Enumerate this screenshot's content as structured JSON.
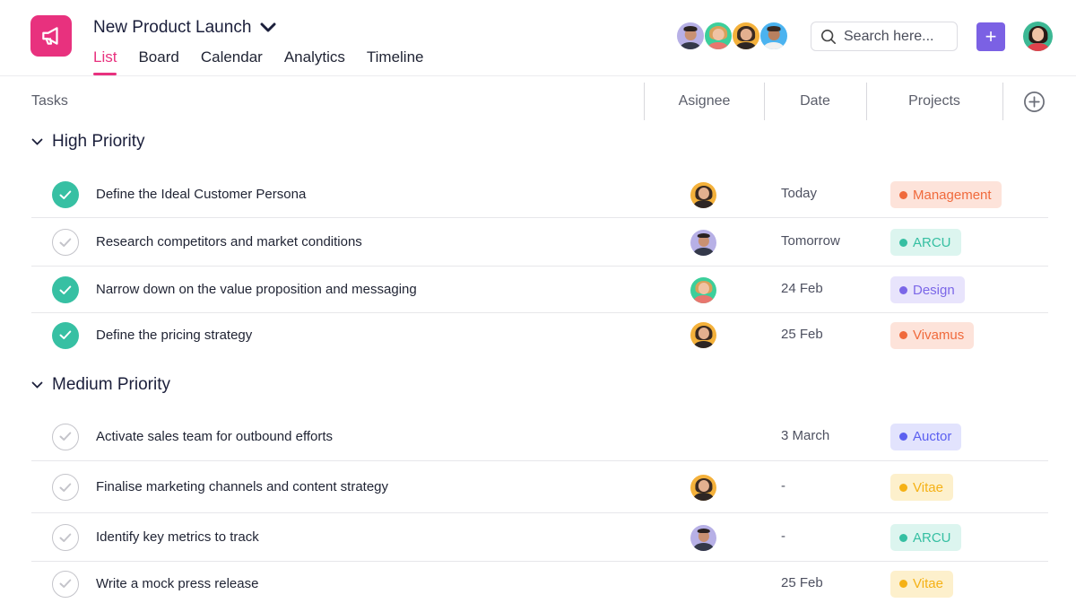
{
  "header": {
    "app_icon": "megaphone-icon",
    "project_title": "New Product Launch",
    "tabs": [
      {
        "label": "List",
        "active": true
      },
      {
        "label": "Board",
        "active": false
      },
      {
        "label": "Calendar",
        "active": false
      },
      {
        "label": "Analytics",
        "active": false
      },
      {
        "label": "Timeline",
        "active": false
      }
    ],
    "search": {
      "placeholder": "Search here..."
    },
    "add_button_label": "+",
    "colors": {
      "brand": "#e8317e",
      "add_button": "#7b61e4",
      "done_check": "#37c0a3"
    }
  },
  "columns": {
    "tasks": "Tasks",
    "assignee": "Asignee",
    "date": "Date",
    "projects": "Projects"
  },
  "groups": [
    {
      "title": "High Priority",
      "tasks": [
        {
          "name": "Define the Ideal Customer Persona",
          "done": true,
          "assignee": "woman-hat",
          "date": "Today",
          "project": {
            "label": "Management",
            "color": "#f06a3c",
            "bg": "#fde3da"
          }
        },
        {
          "name": "Research competitors and market conditions",
          "done": false,
          "assignee": "man-beard",
          "date": "Tomorrow",
          "project": {
            "label": "ARCU",
            "color": "#35bfa2",
            "bg": "#dcf5ef"
          }
        },
        {
          "name": "Narrow down on the value proposition and messaging",
          "done": true,
          "assignee": "woman-curly",
          "date": "24 Feb",
          "project": {
            "label": "Design",
            "color": "#7b67e8",
            "bg": "#e8e4fc"
          }
        },
        {
          "name": "Define the pricing strategy",
          "done": true,
          "assignee": "woman-hat",
          "date": "25 Feb",
          "project": {
            "label": "Vivamus",
            "color": "#f06a3c",
            "bg": "#fde3da"
          }
        }
      ]
    },
    {
      "title": "Medium Priority",
      "tasks": [
        {
          "name": "Activate sales team for outbound efforts",
          "done": false,
          "assignee": "",
          "date": "3 March",
          "project": {
            "label": "Auctor",
            "color": "#5b5ff0",
            "bg": "#e2e3fd"
          }
        },
        {
          "name": "Finalise marketing channels and content strategy",
          "done": false,
          "assignee": "woman-hat",
          "date": "-",
          "project": {
            "label": "Vitae",
            "color": "#f5b115",
            "bg": "#fdf0cc"
          }
        },
        {
          "name": "Identify key metrics to track",
          "done": false,
          "assignee": "man-beard",
          "date": "-",
          "project": {
            "label": "ARCU",
            "color": "#35bfa2",
            "bg": "#dcf5ef"
          }
        },
        {
          "name": "Write a mock press release",
          "done": false,
          "assignee": "",
          "date": "25 Feb",
          "project": {
            "label": "Vitae",
            "color": "#f5b115",
            "bg": "#fdf0cc"
          }
        }
      ]
    }
  ]
}
